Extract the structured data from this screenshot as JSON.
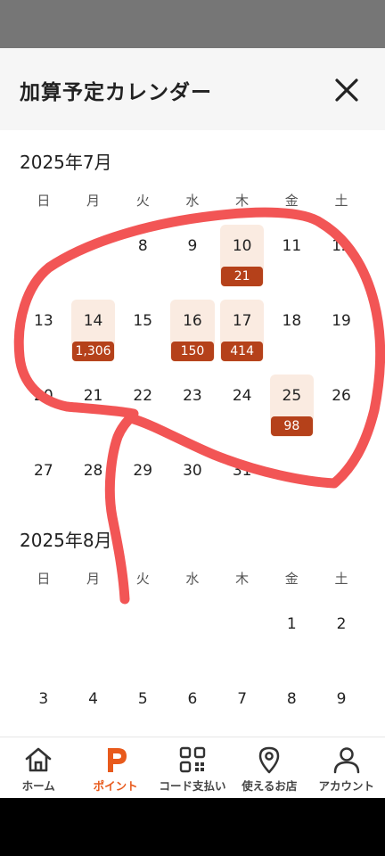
{
  "header": {
    "title": "加算予定カレンダー"
  },
  "weekdays": [
    "日",
    "月",
    "火",
    "水",
    "木",
    "金",
    "土"
  ],
  "months": [
    {
      "title": "2025年7月",
      "weeks": [
        [
          null,
          null,
          {
            "d": "8"
          },
          {
            "d": "9"
          },
          {
            "d": "10",
            "b": "21"
          },
          {
            "d": "11"
          },
          {
            "d": "12"
          }
        ],
        [
          {
            "d": "13"
          },
          {
            "d": "14",
            "b": "1,306"
          },
          {
            "d": "15"
          },
          {
            "d": "16",
            "b": "150"
          },
          {
            "d": "17",
            "b": "414"
          },
          {
            "d": "18"
          },
          {
            "d": "19"
          }
        ],
        [
          {
            "d": "20"
          },
          {
            "d": "21"
          },
          {
            "d": "22"
          },
          {
            "d": "23"
          },
          {
            "d": "24"
          },
          {
            "d": "25",
            "b": "98"
          },
          {
            "d": "26"
          }
        ],
        [
          {
            "d": "27"
          },
          {
            "d": "28"
          },
          {
            "d": "29"
          },
          {
            "d": "30"
          },
          {
            "d": "31"
          },
          null,
          null
        ]
      ]
    },
    {
      "title": "2025年8月",
      "weeks": [
        [
          null,
          null,
          null,
          null,
          null,
          {
            "d": "1"
          },
          {
            "d": "2"
          }
        ],
        [
          {
            "d": "3"
          },
          {
            "d": "4"
          },
          {
            "d": "5"
          },
          {
            "d": "6"
          },
          {
            "d": "7"
          },
          {
            "d": "8"
          },
          {
            "d": "9"
          }
        ]
      ]
    }
  ],
  "tabs": [
    {
      "label": "ホーム",
      "icon": "home-icon"
    },
    {
      "label": "ポイント",
      "icon": "point-p-icon",
      "active": true
    },
    {
      "label": "コード支払い",
      "icon": "qr-code-icon"
    },
    {
      "label": "使えるお店",
      "icon": "location-pin-icon"
    },
    {
      "label": "アカウント",
      "icon": "person-icon"
    }
  ],
  "colors": {
    "accent": "#e85a1c",
    "badge": "#b5411a",
    "highlight": "#faebe1",
    "annotation": "#f25555"
  }
}
